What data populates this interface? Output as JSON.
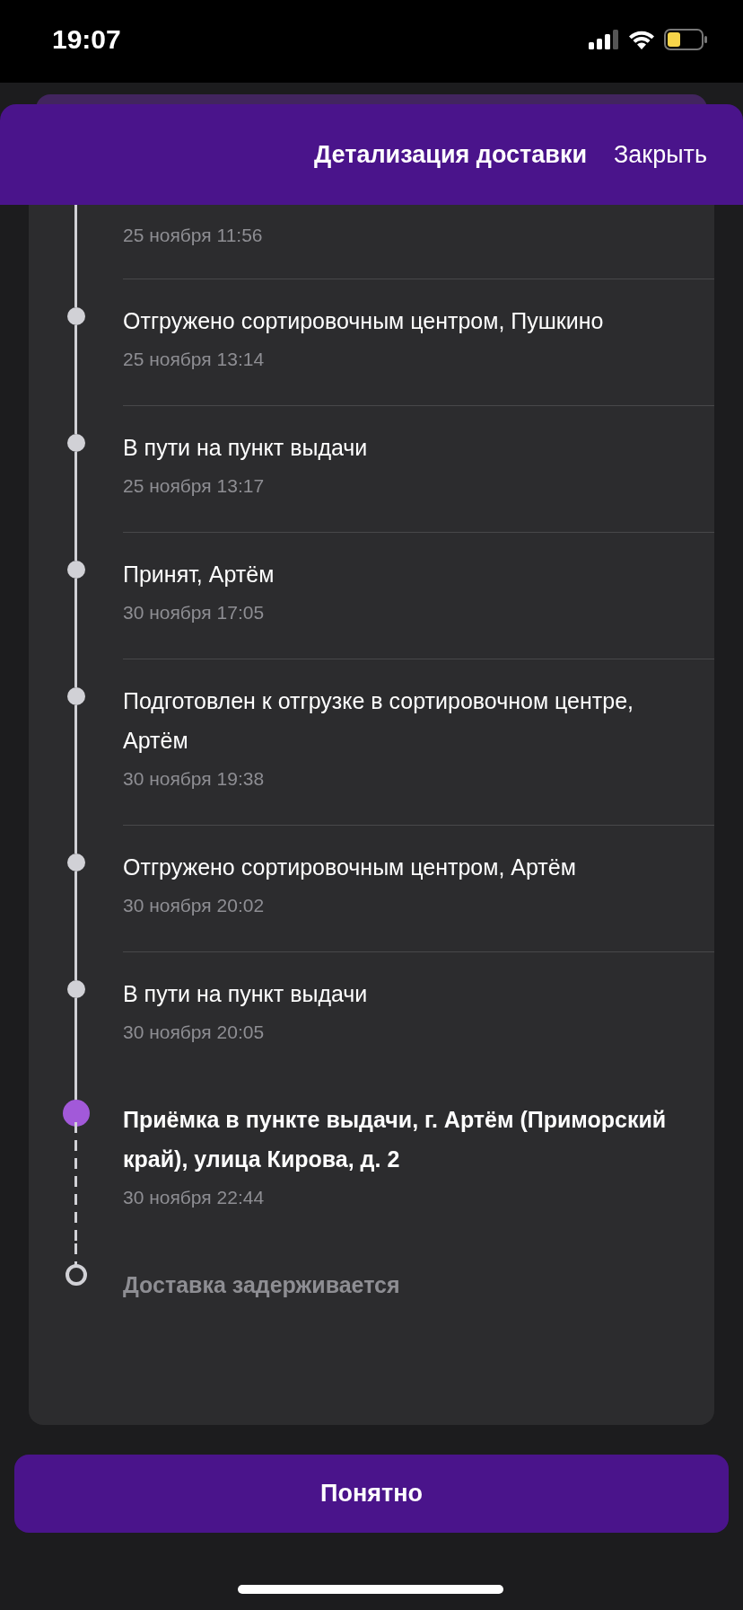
{
  "status_bar": {
    "time": "19:07"
  },
  "header": {
    "title": "Детализация доставки",
    "close": "Закрыть"
  },
  "events": [
    {
      "kind": "done",
      "date": "25 ноября 11:56"
    },
    {
      "kind": "done",
      "title": "Отгружено сортировочным центром, Пушкино",
      "date": "25 ноября 13:14"
    },
    {
      "kind": "done",
      "title": "В пути на пункт выдачи",
      "date": "25 ноября 13:17"
    },
    {
      "kind": "done",
      "title": "Принят, Артём",
      "date": "30 ноября 17:05"
    },
    {
      "kind": "done",
      "title": "Подготовлен к отгрузке в сортировочном центре, Артём",
      "date": "30 ноября 19:38"
    },
    {
      "kind": "done",
      "title": "Отгружено сортировочным центром, Артём",
      "date": "30 ноября 20:02"
    },
    {
      "kind": "done",
      "title": "В пути на пункт выдачи",
      "date": "30 ноября 20:05"
    },
    {
      "kind": "current",
      "title": "Приёмка в пункте выдачи, г. Артём (Приморский край), улица Кирова, д. 2",
      "date": "30 ноября 22:44"
    },
    {
      "kind": "pending",
      "title": "Доставка задерживается"
    }
  ],
  "button": {
    "label": "Понятно"
  }
}
